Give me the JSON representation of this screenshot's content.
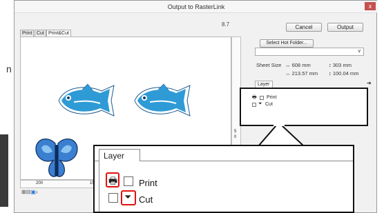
{
  "window": {
    "title": "Output to RasterLink",
    "close_label": "x",
    "version": "8.7"
  },
  "toolbar": {
    "cancel_label": "Cancel",
    "output_label": "Output"
  },
  "tabs": [
    "Print",
    "Cut",
    "Print&Cut"
  ],
  "hot_folder": {
    "button_label": "Select Hot Folder...",
    "value": "",
    "chevron": "v"
  },
  "sheet": {
    "label": "Sheet Size",
    "width1": "608 mm",
    "height1": "303 mm",
    "width2": "213.57 mm",
    "height2": "100.04 mm"
  },
  "layer_panel": {
    "tab_label": "Layer",
    "items": [
      {
        "label": "Print",
        "icon": "printer-icon"
      },
      {
        "label": "Cut",
        "icon": "cut-icon"
      }
    ]
  },
  "ruler": {
    "h_ticks": [
      "200",
      "150"
    ],
    "v_ticks": [
      "5",
      "0"
    ]
  },
  "zoom_callout": {
    "tab_label": "Layer",
    "items": [
      {
        "label": "Print",
        "icon": "printer-icon"
      },
      {
        "label": "Cut",
        "icon": "cut-icon"
      }
    ]
  },
  "bottom_icons": [
    "grid-icon",
    "grid-icon",
    "image-icon"
  ],
  "edge_text": "n",
  "colors": {
    "accent_red": "#e01010",
    "fish_blue": "#2e9bd6",
    "butterfly_blue": "#3b7fd0"
  }
}
